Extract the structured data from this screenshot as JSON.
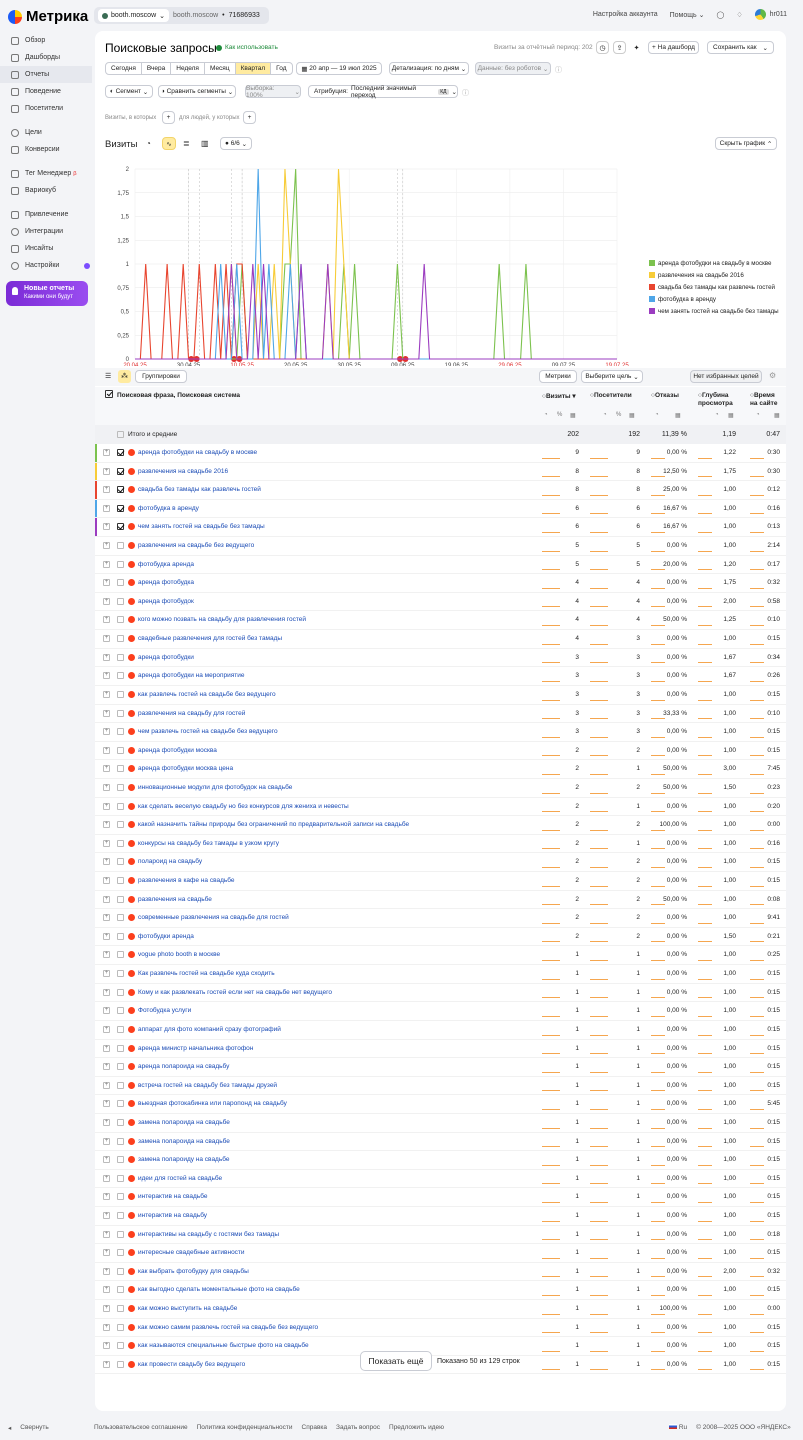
{
  "app": {
    "logo": "Метрика",
    "counter_name": "booth.moscow",
    "counter_site": "booth.moscow",
    "counter_id": "71686933",
    "account_settings": "Настройка аккаунта",
    "help": "Помощь",
    "user": "hr011"
  },
  "sidebar": {
    "items": [
      {
        "label": "Обзор"
      },
      {
        "label": "Дашборды"
      },
      {
        "label": "Отчеты"
      },
      {
        "label": "Поведение"
      },
      {
        "label": "Посетители"
      },
      {
        "label": "Цели"
      },
      {
        "label": "Конверсии"
      },
      {
        "label": "Тег Менеджер"
      },
      {
        "label": "Вариокуб"
      },
      {
        "label": "Привлечение"
      },
      {
        "label": "Интеграции"
      },
      {
        "label": "Инсайты"
      },
      {
        "label": "Настройки"
      }
    ],
    "promo_title": "Новые отчеты",
    "promo_sub": "Какими они будут",
    "collapse": "Свернуть"
  },
  "report": {
    "title": "Поисковые запросы",
    "howto": "Как использовать",
    "visits_period": "Визиты за отчётный период: 202",
    "to_dashboard": "На дашборд",
    "save_as": "Сохранить как",
    "periods": [
      "Сегодня",
      "Вчера",
      "Неделя",
      "Месяц",
      "Квартал",
      "Год"
    ],
    "date_range": "20 апр — 19 июл 2025",
    "detail": "Детализация: по дням",
    "robots": "Данные: без роботов",
    "segment": "Сегмент",
    "compare": "Сравнить сегменты",
    "sample": "Выборка: 100%",
    "attribution": "Последний значимый переход",
    "attr_label": "Атрибуция:",
    "attr_badge": "КД",
    "visits_which": "Визиты, в которых",
    "people_which": "для людей, у которых",
    "chart_title": "Визиты",
    "series_count": "6/6",
    "hide_chart": "Скрыть график"
  },
  "colors": {
    "s1": "#7cc24e",
    "s2": "#f7cc38",
    "s3": "#e8452f",
    "s4": "#4ea6e8",
    "s5": "#9b3cc0"
  },
  "chart_data": {
    "type": "line",
    "title": "",
    "ylim": [
      0,
      2
    ],
    "yticks": [
      "0",
      "0,25",
      "0,5",
      "0,75",
      "1",
      "1,25",
      "1,5",
      "1,75",
      "2"
    ],
    "xticks": [
      {
        "label": "20.04.25",
        "red": true
      },
      {
        "label": "30.04.25",
        "red": false
      },
      {
        "label": "10.05.25",
        "red": true
      },
      {
        "label": "20.05.25",
        "red": false
      },
      {
        "label": "30.05.25",
        "red": false
      },
      {
        "label": "09.06.25",
        "red": false
      },
      {
        "label": "19.06.25",
        "red": false
      },
      {
        "label": "29.06.25",
        "red": true
      },
      {
        "label": "09.07.25",
        "red": false
      },
      {
        "label": "19.07.25",
        "red": true
      }
    ],
    "series": [
      {
        "name": "аренда фотобудки на свадьбу в москве",
        "color": "#7cc24e",
        "points": [
          [
            20,
            1
          ],
          [
            28,
            1
          ],
          [
            29,
            1
          ],
          [
            30,
            2
          ],
          [
            39,
            1
          ],
          [
            41,
            1
          ],
          [
            49,
            1
          ],
          [
            68,
            1
          ],
          [
            73,
            1
          ]
        ]
      },
      {
        "name": "развлечения на свадьбе 2016",
        "color": "#f7cc38",
        "points": [
          [
            18,
            1
          ],
          [
            23,
            1
          ],
          [
            26,
            1
          ],
          [
            28,
            2
          ],
          [
            29,
            1
          ],
          [
            36,
            1
          ],
          [
            38,
            2
          ],
          [
            39,
            1
          ]
        ]
      },
      {
        "name": "свадьба без тамады как развлечь гостей",
        "color": "#e8452f",
        "points": [
          [
            2,
            1
          ],
          [
            6,
            1
          ],
          [
            9,
            1
          ],
          [
            12,
            1
          ],
          [
            15,
            1
          ],
          [
            17,
            1
          ],
          [
            19,
            1
          ],
          [
            20,
            1
          ]
        ]
      },
      {
        "name": "фотобудка в аренду",
        "color": "#4ea6e8",
        "points": [
          [
            16,
            1
          ],
          [
            19,
            1
          ],
          [
            23,
            2
          ],
          [
            25,
            1
          ],
          [
            29,
            1
          ],
          [
            31,
            1
          ]
        ]
      },
      {
        "name": "чем занять гостей на свадьбе без тамады",
        "color": "#9b3cc0",
        "points": [
          [
            18,
            1
          ],
          [
            22,
            1
          ],
          [
            24,
            1
          ],
          [
            31,
            1
          ],
          [
            36,
            1
          ],
          [
            54,
            1
          ]
        ]
      }
    ]
  },
  "table": {
    "top_groupings": "Группировки",
    "top_metrics": "Метрики",
    "top_goal": "Выберите цель",
    "top_fav": "Нет избранных целей",
    "dimension_header": "Поисковая фраза, Поисковая система",
    "columns": [
      "Визиты",
      "Посетители",
      "Отказы",
      "Глубина просмотра",
      "Время на сайте"
    ],
    "totals": {
      "label": "Итого и средние",
      "visits": "202",
      "visitors": "192",
      "bounce": "11,39 %",
      "depth": "1,19",
      "time": "0:47"
    },
    "rows": [
      {
        "phrase": "аренда фотобудки на свадьбу в москве",
        "v": "9",
        "u": "9",
        "b": "0,00 %",
        "d": "1,22",
        "t": "0:30",
        "on": true,
        "c": "#7cc24e"
      },
      {
        "phrase": "развлечения на свадьбе 2016",
        "v": "8",
        "u": "8",
        "b": "12,50 %",
        "d": "1,75",
        "t": "0:30",
        "on": true,
        "c": "#f7cc38"
      },
      {
        "phrase": "свадьба без тамады как развлечь гостей",
        "v": "8",
        "u": "8",
        "b": "25,00 %",
        "d": "1,00",
        "t": "0:12",
        "on": true,
        "c": "#e8452f"
      },
      {
        "phrase": "фотобудка в аренду",
        "v": "6",
        "u": "6",
        "b": "16,67 %",
        "d": "1,00",
        "t": "0:16",
        "on": true,
        "c": "#4ea6e8"
      },
      {
        "phrase": "чем занять гостей на свадьбе без тамады",
        "v": "6",
        "u": "6",
        "b": "16,67 %",
        "d": "1,00",
        "t": "0:13",
        "on": true,
        "c": "#9b3cc0"
      },
      {
        "phrase": "развлечения на свадьбе без ведущего",
        "v": "5",
        "u": "5",
        "b": "0,00 %",
        "d": "1,00",
        "t": "2:14"
      },
      {
        "phrase": "фотобудка аренда",
        "v": "5",
        "u": "5",
        "b": "20,00 %",
        "d": "1,20",
        "t": "0:17"
      },
      {
        "phrase": "аренда фотобудка",
        "v": "4",
        "u": "4",
        "b": "0,00 %",
        "d": "1,75",
        "t": "0:32"
      },
      {
        "phrase": "аренда фотобудок",
        "v": "4",
        "u": "4",
        "b": "0,00 %",
        "d": "2,00",
        "t": "0:58"
      },
      {
        "phrase": "кого можно позвать на свадьбу для развлечения гостей",
        "v": "4",
        "u": "4",
        "b": "50,00 %",
        "d": "1,25",
        "t": "0:10"
      },
      {
        "phrase": "свадебные развлечения для гостей без тамады",
        "v": "4",
        "u": "3",
        "b": "0,00 %",
        "d": "1,00",
        "t": "0:15"
      },
      {
        "phrase": "аренда фотобудки",
        "v": "3",
        "u": "3",
        "b": "0,00 %",
        "d": "1,67",
        "t": "0:34"
      },
      {
        "phrase": "аренда фотобудки на мероприятие",
        "v": "3",
        "u": "3",
        "b": "0,00 %",
        "d": "1,67",
        "t": "0:26"
      },
      {
        "phrase": "как развлечь гостей на свадьбе без ведущего",
        "v": "3",
        "u": "3",
        "b": "0,00 %",
        "d": "1,00",
        "t": "0:15"
      },
      {
        "phrase": "развлечения на свадьбу для гостей",
        "v": "3",
        "u": "3",
        "b": "33,33 %",
        "d": "1,00",
        "t": "0:10"
      },
      {
        "phrase": "чем развлечь гостей на свадьбе без ведущего",
        "v": "3",
        "u": "3",
        "b": "0,00 %",
        "d": "1,00",
        "t": "0:15"
      },
      {
        "phrase": "аренда фотобудки москва",
        "v": "2",
        "u": "2",
        "b": "0,00 %",
        "d": "1,00",
        "t": "0:15"
      },
      {
        "phrase": "аренда фотобудки москва цена",
        "v": "2",
        "u": "1",
        "b": "50,00 %",
        "d": "3,00",
        "t": "7:45"
      },
      {
        "phrase": "инновационные модули для фотобудок на свадьбе",
        "v": "2",
        "u": "2",
        "b": "50,00 %",
        "d": "1,50",
        "t": "0:23"
      },
      {
        "phrase": "как сделать веселую свадьбу но без конкурсов для жениха и невесты",
        "v": "2",
        "u": "1",
        "b": "0,00 %",
        "d": "1,00",
        "t": "0:20"
      },
      {
        "phrase": "какой назначить тайны природы без ограничений по предварительной записи на свадьбе",
        "v": "2",
        "u": "2",
        "b": "100,00 %",
        "d": "1,00",
        "t": "0:00"
      },
      {
        "phrase": "конкурсы на свадьбу без тамады в узком кругу",
        "v": "2",
        "u": "1",
        "b": "0,00 %",
        "d": "1,00",
        "t": "0:16"
      },
      {
        "phrase": "полароид на свадьбу",
        "v": "2",
        "u": "2",
        "b": "0,00 %",
        "d": "1,00",
        "t": "0:15"
      },
      {
        "phrase": "развлечения в кафе на свадьбе",
        "v": "2",
        "u": "2",
        "b": "0,00 %",
        "d": "1,00",
        "t": "0:15"
      },
      {
        "phrase": "развлечения на свадьбе",
        "v": "2",
        "u": "2",
        "b": "50,00 %",
        "d": "1,00",
        "t": "0:08"
      },
      {
        "phrase": "современные развлечения на свадьбе для гостей",
        "v": "2",
        "u": "2",
        "b": "0,00 %",
        "d": "1,00",
        "t": "9:41"
      },
      {
        "phrase": "фотобудки аренда",
        "v": "2",
        "u": "2",
        "b": "0,00 %",
        "d": "1,50",
        "t": "0:21"
      },
      {
        "phrase": "vogue photo booth в москве",
        "v": "1",
        "u": "1",
        "b": "0,00 %",
        "d": "1,00",
        "t": "0:25"
      },
      {
        "phrase": "Как развлечь гостей на свадьбе куда сходить",
        "v": "1",
        "u": "1",
        "b": "0,00 %",
        "d": "1,00",
        "t": "0:15"
      },
      {
        "phrase": "Кому и как развлекать гостей если нет на свадьбе нет ведущего",
        "v": "1",
        "u": "1",
        "b": "0,00 %",
        "d": "1,00",
        "t": "0:15"
      },
      {
        "phrase": "Фотобудка услуги",
        "v": "1",
        "u": "1",
        "b": "0,00 %",
        "d": "1,00",
        "t": "0:15"
      },
      {
        "phrase": "аппарат для фото компаний сразу фотографий",
        "v": "1",
        "u": "1",
        "b": "0,00 %",
        "d": "1,00",
        "t": "0:15"
      },
      {
        "phrase": "аренда министр начальника фотофон",
        "v": "1",
        "u": "1",
        "b": "0,00 %",
        "d": "1,00",
        "t": "0:15"
      },
      {
        "phrase": "аренда полароида на свадьбу",
        "v": "1",
        "u": "1",
        "b": "0,00 %",
        "d": "1,00",
        "t": "0:15"
      },
      {
        "phrase": "встреча гостей на свадьбу без тамады друзей",
        "v": "1",
        "u": "1",
        "b": "0,00 %",
        "d": "1,00",
        "t": "0:15"
      },
      {
        "phrase": "выездная фотокабинка или паропонд на свадьбу",
        "v": "1",
        "u": "1",
        "b": "0,00 %",
        "d": "1,00",
        "t": "5:45"
      },
      {
        "phrase": "замена полароида на свадьбе",
        "v": "1",
        "u": "1",
        "b": "0,00 %",
        "d": "1,00",
        "t": "0:15"
      },
      {
        "phrase": "замена полароида на свадьбе",
        "v": "1",
        "u": "1",
        "b": "0,00 %",
        "d": "1,00",
        "t": "0:15"
      },
      {
        "phrase": "замена полароиду на свадьбе",
        "v": "1",
        "u": "1",
        "b": "0,00 %",
        "d": "1,00",
        "t": "0:15"
      },
      {
        "phrase": "идеи для гостей на свадьбе",
        "v": "1",
        "u": "1",
        "b": "0,00 %",
        "d": "1,00",
        "t": "0:15"
      },
      {
        "phrase": "интерактив на свадьбе",
        "v": "1",
        "u": "1",
        "b": "0,00 %",
        "d": "1,00",
        "t": "0:15"
      },
      {
        "phrase": "интерактив на свадьбу",
        "v": "1",
        "u": "1",
        "b": "0,00 %",
        "d": "1,00",
        "t": "0:15"
      },
      {
        "phrase": "интерактивы на свадьбу с гостями без тамады",
        "v": "1",
        "u": "1",
        "b": "0,00 %",
        "d": "1,00",
        "t": "0:18"
      },
      {
        "phrase": "интересные свадебные активности",
        "v": "1",
        "u": "1",
        "b": "0,00 %",
        "d": "1,00",
        "t": "0:15"
      },
      {
        "phrase": "как выбрать фотобудку для свадьбы",
        "v": "1",
        "u": "1",
        "b": "0,00 %",
        "d": "2,00",
        "t": "0:32"
      },
      {
        "phrase": "как выгодно сделать моментальные фото на свадьбе",
        "v": "1",
        "u": "1",
        "b": "0,00 %",
        "d": "1,00",
        "t": "0:15"
      },
      {
        "phrase": "как можно выступить на свадьбе",
        "v": "1",
        "u": "1",
        "b": "100,00 %",
        "d": "1,00",
        "t": "0:00"
      },
      {
        "phrase": "как можно самим развлечь гостей на свадьбе без ведущего",
        "v": "1",
        "u": "1",
        "b": "0,00 %",
        "d": "1,00",
        "t": "0:15"
      },
      {
        "phrase": "как называются специальные быстрые фото на свадьбе",
        "v": "1",
        "u": "1",
        "b": "0,00 %",
        "d": "1,00",
        "t": "0:15"
      },
      {
        "phrase": "как провести свадьбу без ведущего",
        "v": "1",
        "u": "1",
        "b": "0,00 %",
        "d": "1,00",
        "t": "0:15"
      }
    ],
    "show_more": "Показать ещё",
    "shown_count": "Показано 50 из 129 строк"
  },
  "footer": {
    "links": [
      "Пользовательское соглашение",
      "Политика конфиденциальности",
      "Справка",
      "Задать вопрос",
      "Предложить идею"
    ],
    "lang": "Ru",
    "copyright": "© 2008—2025 ООО «ЯНДЕКС»"
  }
}
